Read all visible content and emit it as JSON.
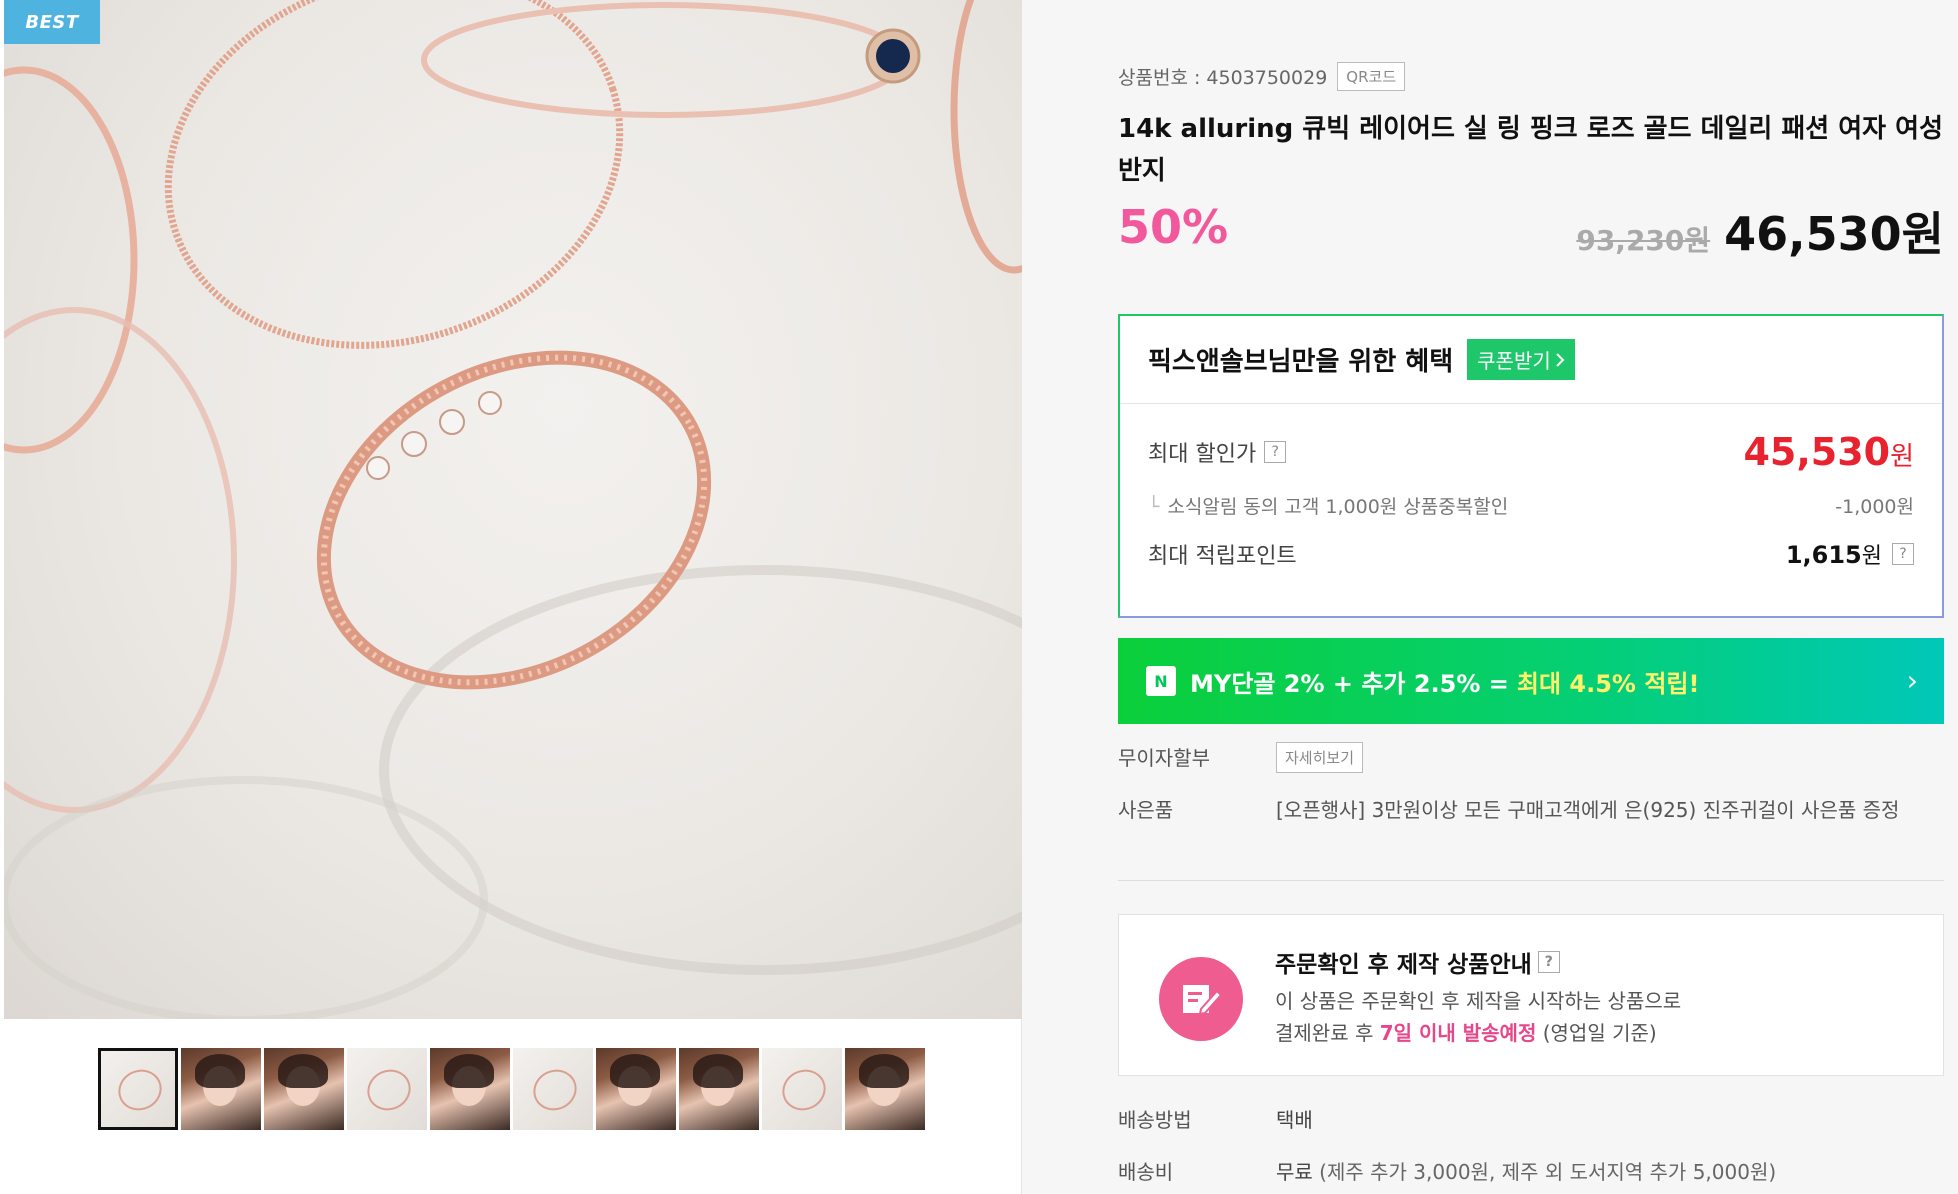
{
  "badge": {
    "label": "BEST"
  },
  "product": {
    "number_label": "상품번호 : 4503750029",
    "qr_label": "QR코드",
    "title": "14k alluring 큐빅 레이어드 실 링 핑크 로즈 골드 데일리 패션 여자 여성 반지",
    "discount": "50%",
    "original_price": "93,230원",
    "final_price": "46,530원"
  },
  "benefit": {
    "title": "픽스앤솔브님만을 위한 혜택",
    "coupon_label": "쿠폰받기",
    "max_discount_label": "최대 할인가",
    "max_discount_value": "45,530",
    "won": "원",
    "sub_label": "소식알림 동의 고객 1,000원 상품중복할인",
    "sub_value": "-1,000원",
    "point_label": "최대 적립포인트",
    "point_value": "1,615",
    "point_unit": "원",
    "help": "?"
  },
  "my_banner": {
    "logo": "N",
    "text": "MY단골 2% + 추가 2.5% =",
    "highlight": "최대 4.5% 적립!",
    "chevron": "›"
  },
  "info": {
    "installment_label": "무이자할부",
    "installment_button": "자세히보기",
    "gift_label": "사은품",
    "gift_text": "[오픈행사] 3만원이상 모든 구매고객에게 은(925) 진주귀걸이 사은품 증정",
    "shipping_method_label": "배송방법",
    "shipping_method_value": "택배",
    "shipping_fee_label": "배송비",
    "shipping_fee_value": "무료",
    "shipping_fee_note": "(제주 추가 3,000원, 제주 외 도서지역 추가 5,000원)"
  },
  "made_to_order": {
    "title": "주문확인 후 제작 상품안내",
    "line1": "이 상품은 주문확인 후 제작을 시작하는 상품으로",
    "line2_prefix": "결제완료 후",
    "line2_highlight": "7일 이내 발송예정",
    "line2_suffix": "(영업일 기준)"
  },
  "colors": {
    "accent_pink": "#f2589c",
    "price_red": "#e8222e",
    "naver_green": "#1ec86a",
    "badge_blue": "#4fb3e0"
  }
}
